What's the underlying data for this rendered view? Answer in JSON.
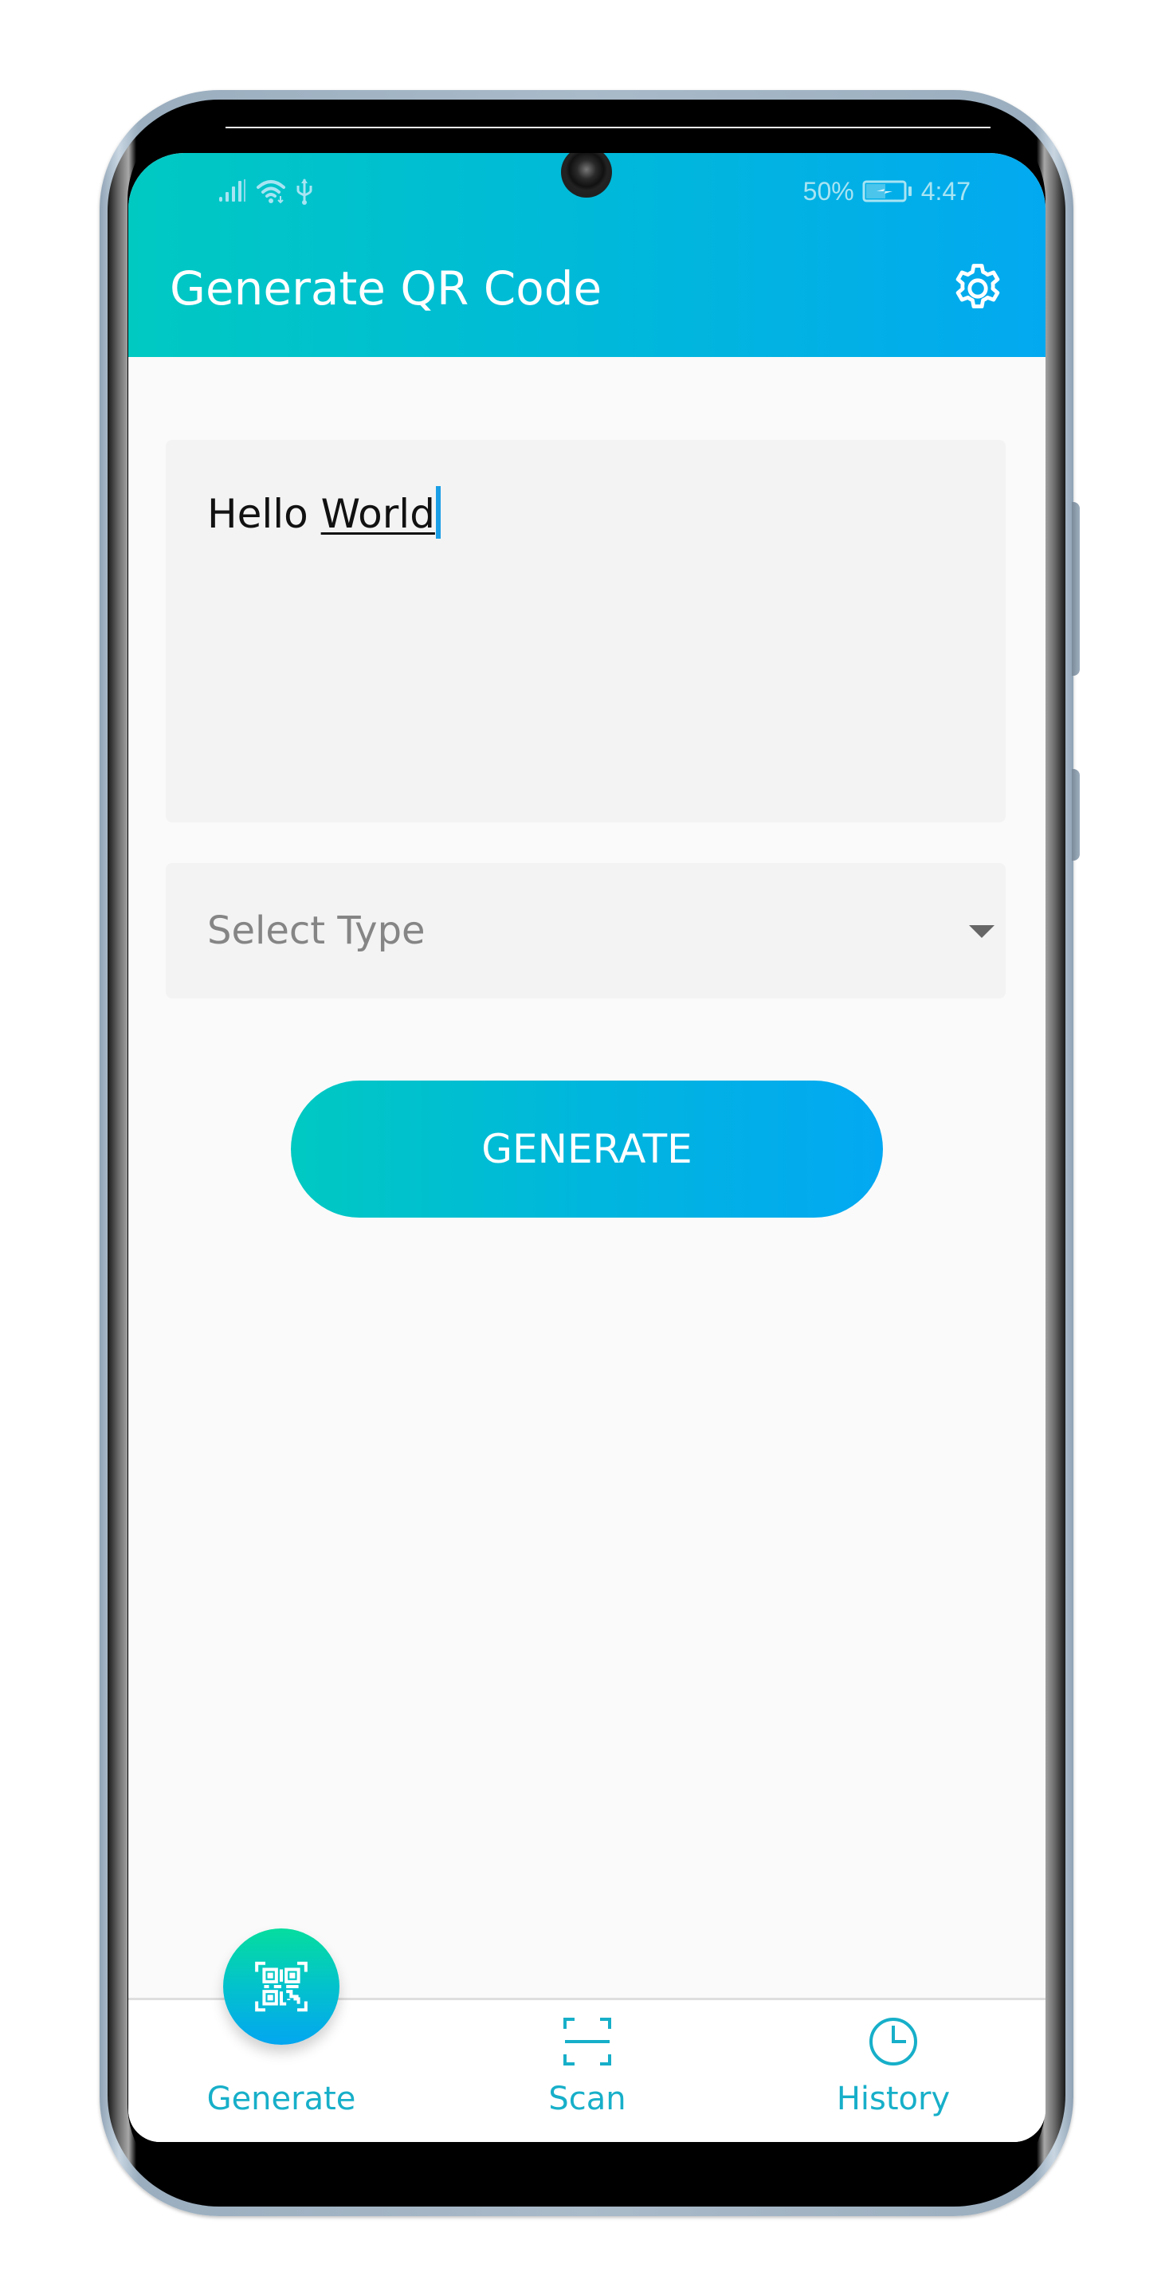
{
  "status_bar": {
    "battery_percent": "50%",
    "time": "4:47",
    "icons": [
      "signal-icon",
      "wifi-icon",
      "usb-icon",
      "battery-charging-icon"
    ]
  },
  "app_bar": {
    "title": "Generate QR Code",
    "settings_icon": "gear-icon"
  },
  "form": {
    "text_input": {
      "value_part1": "Hello ",
      "value_part2": "World",
      "full_value": "Hello World"
    },
    "type_select": {
      "placeholder": "Select Type",
      "icon": "dropdown-arrow-icon"
    },
    "generate_button": "GENERATE"
  },
  "bottom_nav": {
    "items": [
      {
        "label": "Generate",
        "icon": "qr-code-icon",
        "active": true
      },
      {
        "label": "Scan",
        "icon": "scan-icon",
        "active": false
      },
      {
        "label": "History",
        "icon": "clock-icon",
        "active": false
      }
    ]
  },
  "colors": {
    "accent_start": "#00c9c2",
    "accent_end": "#03a9f0",
    "nav_label": "#17afc9",
    "background": "#fafafa",
    "input_background": "#f3f3f3"
  }
}
